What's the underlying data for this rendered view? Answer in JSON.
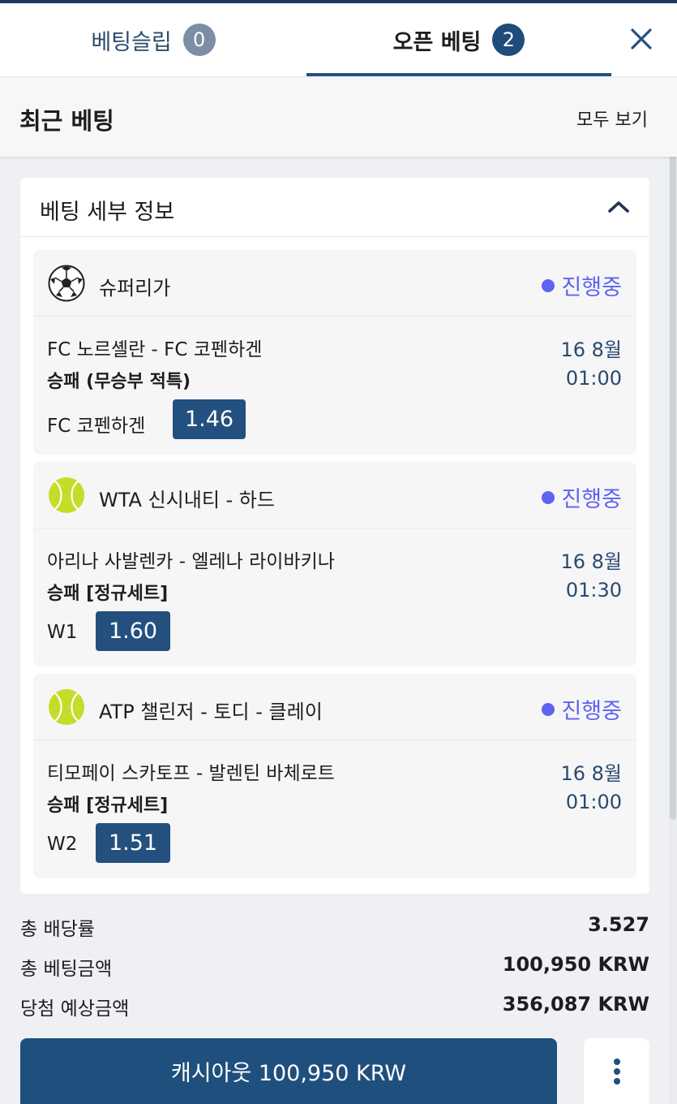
{
  "header": {
    "tabs": [
      {
        "label": "베팅슬립",
        "count": "0"
      },
      {
        "label": "오픈 베팅",
        "count": "2"
      }
    ],
    "close_icon": "close-icon"
  },
  "recent": {
    "title": "최근 베팅",
    "see_all": "모두 보기"
  },
  "details": {
    "title": "베팅 세부 정보",
    "toggle_icon": "chevron-up-icon",
    "bets": [
      {
        "sport_icon": "soccer-ball-icon",
        "league": "슈퍼리가",
        "status": "진행중",
        "match": "FC 노르셸란 - FC 코펜하겐",
        "market": "승패 (무승부 적특)",
        "date": "16 8월",
        "time": "01:00",
        "selection": "FC 코펜하겐",
        "odds": "1.46"
      },
      {
        "sport_icon": "tennis-ball-icon",
        "league": "WTA 신시내티 - 하드",
        "status": "진행중",
        "match": "아리나 사발렌카 - 엘레나 라이바키나",
        "market": "승패 [정규세트]",
        "date": "16 8월",
        "time": "01:30",
        "selection": "W1",
        "odds": "1.60"
      },
      {
        "sport_icon": "tennis-ball-icon",
        "league": "ATP 챌린저 - 토디 - 클레이",
        "status": "진행중",
        "match": "티모페이 스카토프 - 발렌틴 바체로트",
        "market": "승패 [정규세트]",
        "date": "16 8월",
        "time": "01:00",
        "selection": "W2",
        "odds": "1.51"
      }
    ]
  },
  "summary": {
    "total_odds_label": "총 배당률",
    "total_odds": "3.527",
    "total_stake_label": "총 베팅금액",
    "total_stake": "100,950 KRW",
    "potential_win_label": "당첨 예상금액",
    "potential_win": "356,087 KRW"
  },
  "actions": {
    "cashout_label": "캐시아웃 100,950 KRW",
    "more_icon": "more-vertical-icon"
  },
  "colors": {
    "primary": "#1f4f7d",
    "status": "#5f63f0",
    "tennis_ball": "#c6dc2a"
  }
}
